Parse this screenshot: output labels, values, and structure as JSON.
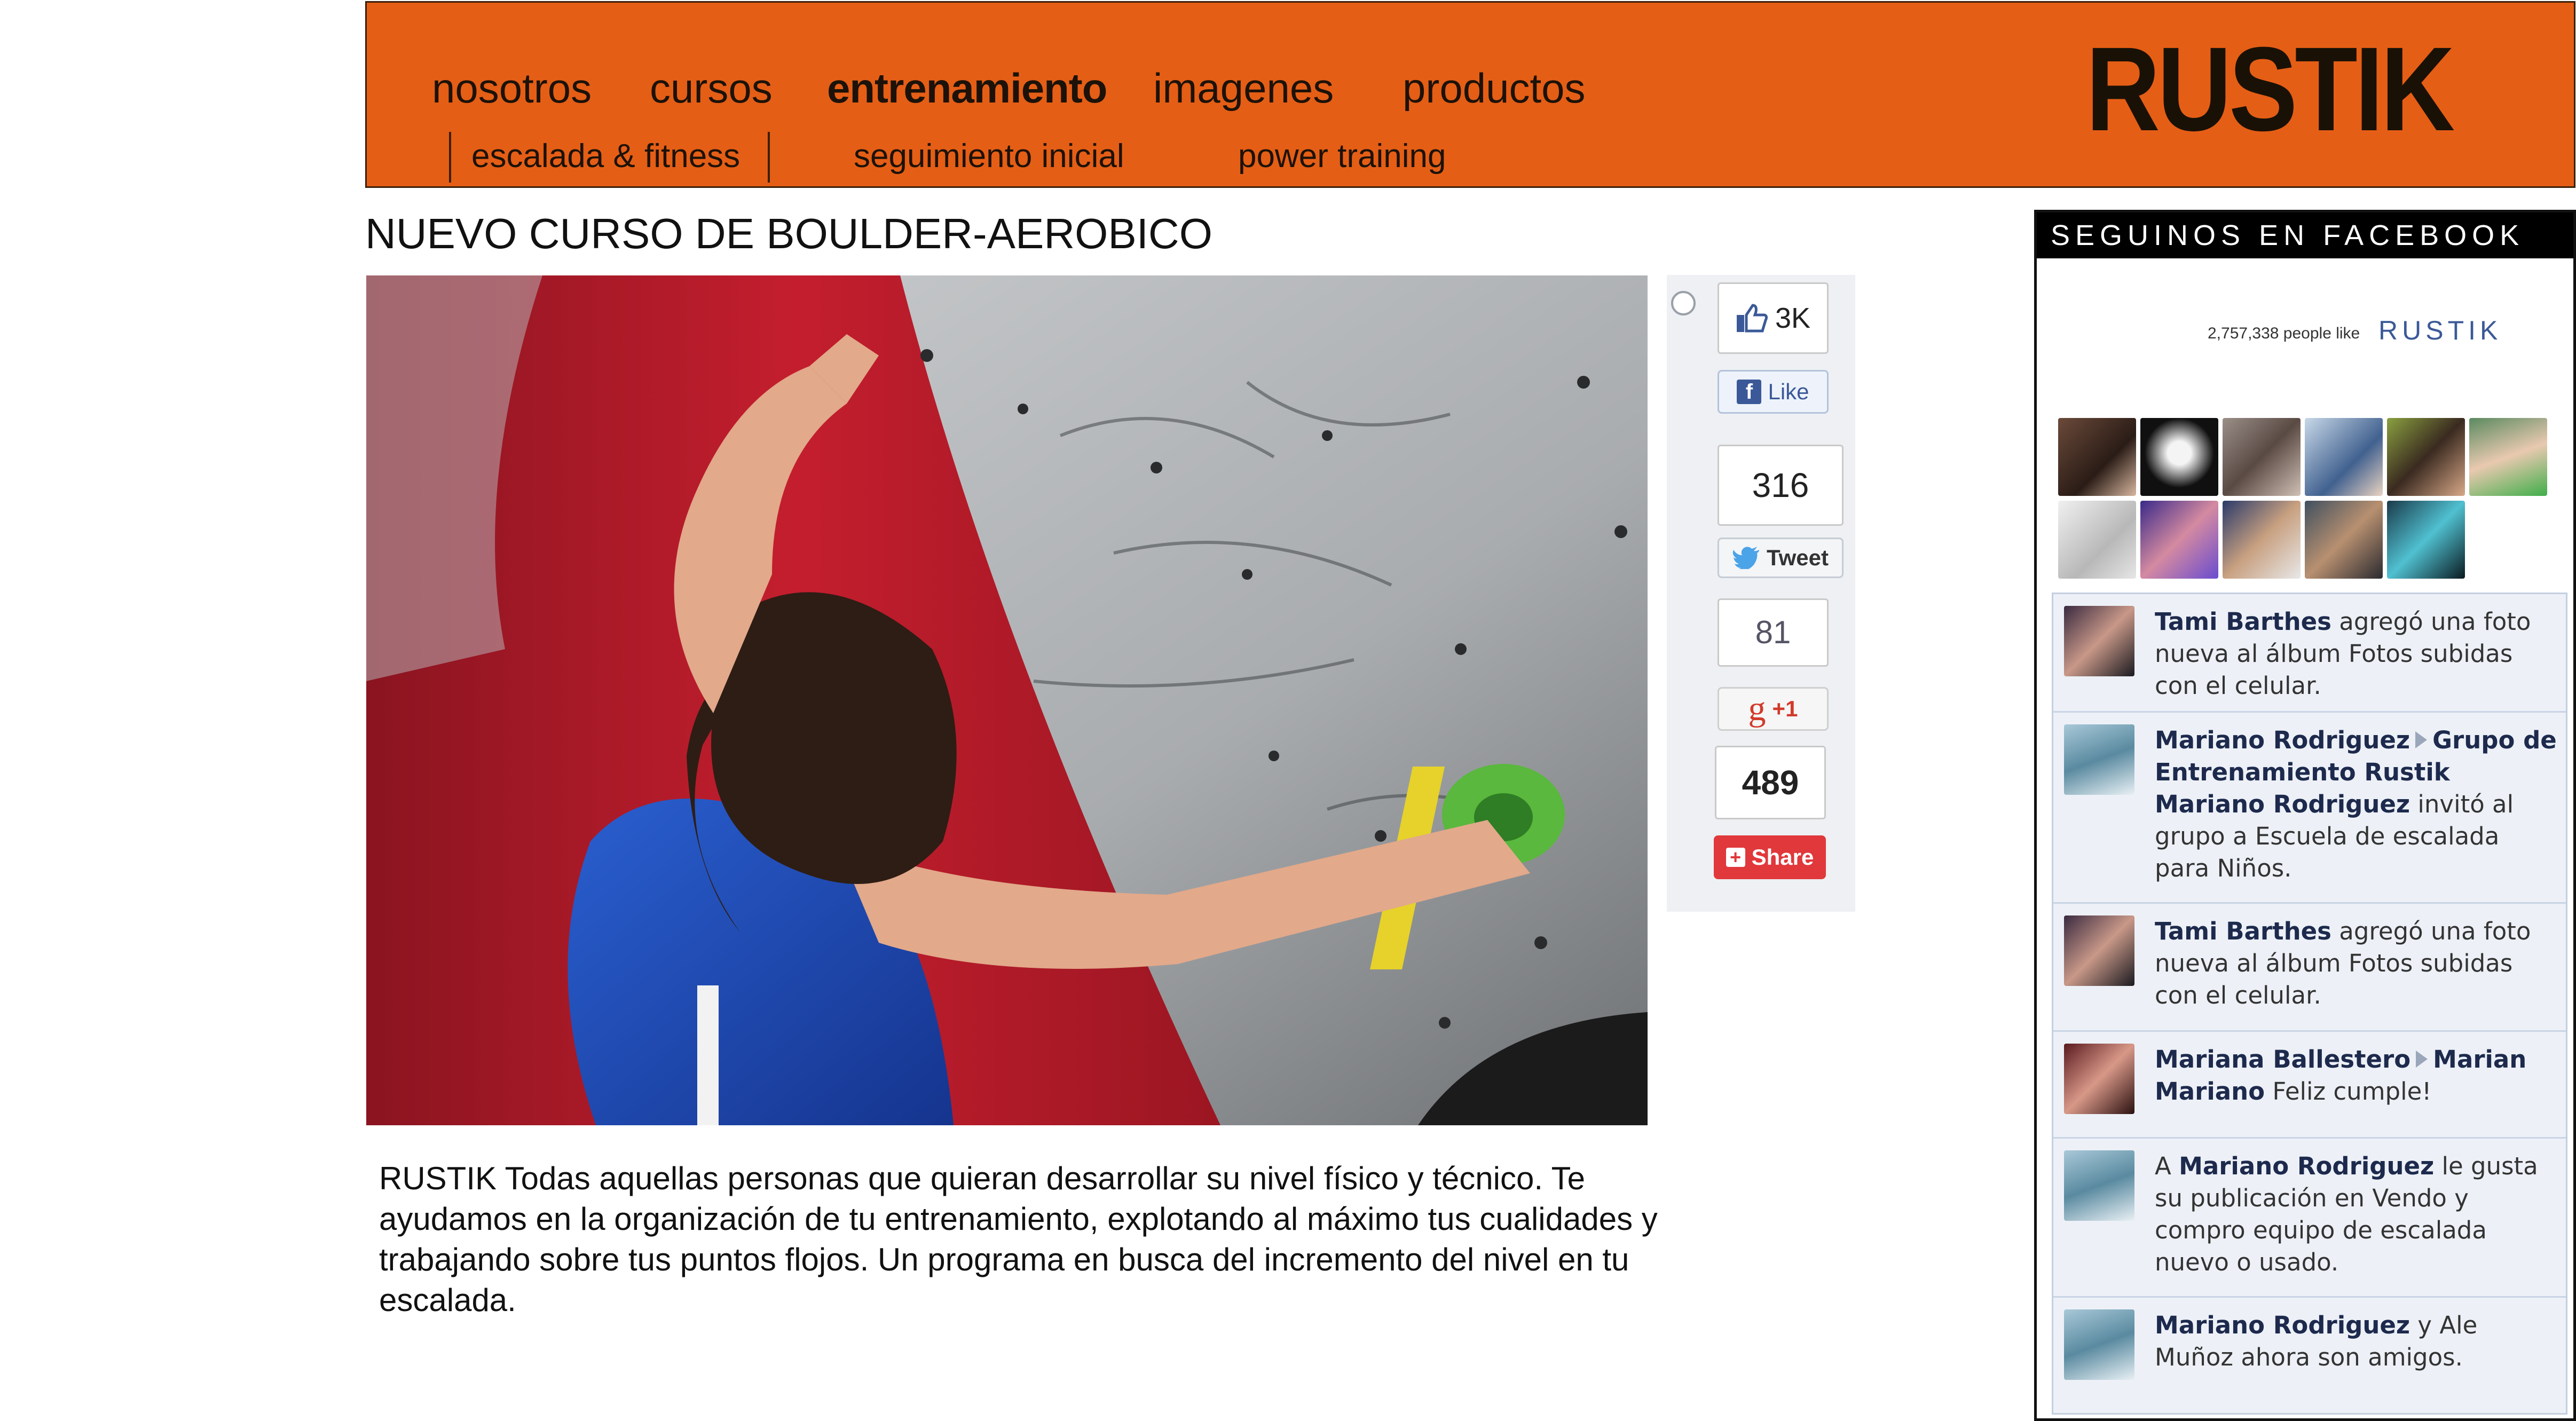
{
  "header": {
    "brand": "RUSTIK",
    "nav": [
      "nosotros",
      "cursos",
      "entrenamiento",
      "imagenes",
      "productos"
    ],
    "active_nav": "entrenamiento",
    "subnav": [
      "escalada & fitness",
      "seguimiento inicial",
      "power training"
    ]
  },
  "main": {
    "title": "NUEVO CURSO DE  BOULDER-AEROBICO",
    "description": "RUSTIK Todas aquellas personas que quieran desarrollar su nivel físico y técnico. Te ayudamos en la organización de tu entrenamiento, explotando al máximo tus cualidades y trabajando sobre tus puntos flojos. Un programa en busca del incremento del nivel en tu escalada."
  },
  "share": {
    "fb_count": "3K",
    "like_label": "Like",
    "tweet_count": "316",
    "tweet_label": "Tweet",
    "plus_count": "81",
    "plus_label": "+1",
    "share_count": "489",
    "share_label": "Share"
  },
  "facebook": {
    "header": "SEGUINOS EN FACEBOOK",
    "likes_text": "2,757,338 people like",
    "page_name": "RUSTIK",
    "posts": [
      {
        "author": "Tami Barthes",
        "text": " agregó una foto nueva al álbum Fotos subidas con el celular."
      },
      {
        "author": "Mariano Rodriguez",
        "target": "Grupo de Entrenamiento Rustik Mariano Rodriguez",
        "text": " invitó al grupo a Escuela de escalada para Niños."
      },
      {
        "author": "Tami Barthes",
        "text": " agregó una foto nueva al álbum Fotos subidas con el celular."
      },
      {
        "author": "Mariana Ballestero",
        "target": "Marian Mariano",
        "text": " Feliz cumple!"
      },
      {
        "prefix": "A ",
        "author": "Mariano Rodriguez",
        "text": " le gusta su publicación en Vendo y compro equipo de escalada nuevo o usado."
      },
      {
        "author": "Mariano Rodriguez",
        "text": " y Ale Muñoz ahora son amigos."
      }
    ]
  },
  "colors": {
    "header_bg": "#e55e16",
    "fb_blue": "#3b5998",
    "share_red": "#e0383b"
  },
  "icons": [
    "facebook-thumb-icon",
    "facebook-f-icon",
    "twitter-bird-icon",
    "google-g-icon",
    "share-plus-icon",
    "radio-icon"
  ]
}
